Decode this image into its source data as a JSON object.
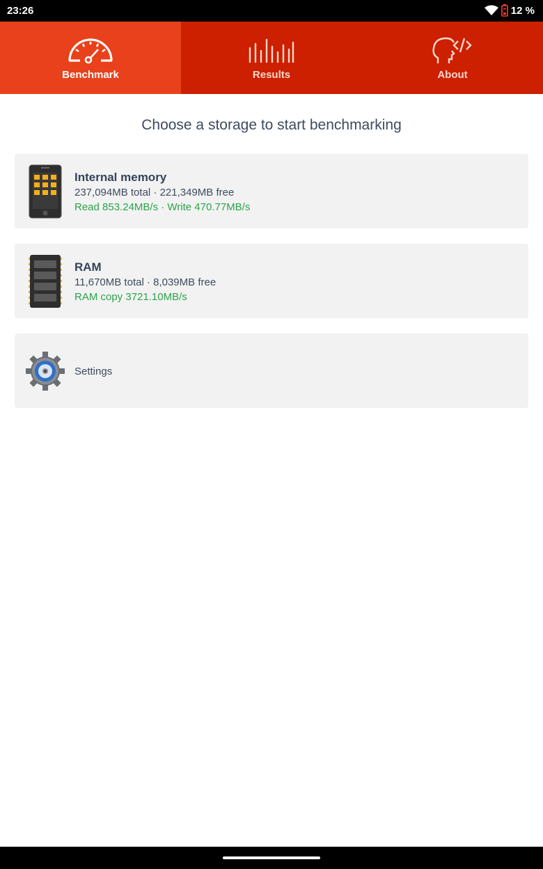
{
  "status_bar": {
    "time": "23:26",
    "battery_percent": "12 %",
    "icons": [
      "wifi-icon",
      "battery-low-icon"
    ]
  },
  "tabs": [
    {
      "label": "Benchmark",
      "icon": "speedometer-icon",
      "active": true
    },
    {
      "label": "Results",
      "icon": "bars-icon",
      "active": false
    },
    {
      "label": "About",
      "icon": "head-code-icon",
      "active": false
    }
  ],
  "heading": "Choose a storage to start benchmarking",
  "storages": [
    {
      "title": "Internal memory",
      "subtitle": "237,094MB total · 221,349MB free",
      "speed": "Read 853.24MB/s · Write 470.77MB/s",
      "icon": "phone-icon"
    },
    {
      "title": "RAM",
      "subtitle": "11,670MB total · 8,039MB free",
      "speed": "RAM copy 3721.10MB/s",
      "icon": "ram-chip-icon"
    }
  ],
  "settings": {
    "label": "Settings",
    "icon": "gear-icon"
  },
  "colors": {
    "tab_active": "#e8411b",
    "tab_bar": "#cc2000",
    "speed_text": "#2aa44a",
    "card_bg": "#f2f2f2"
  }
}
